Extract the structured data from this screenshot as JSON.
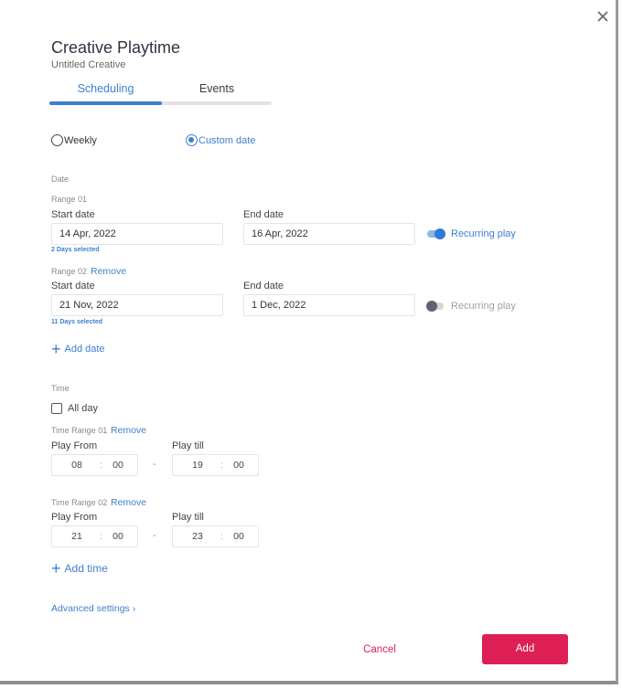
{
  "dialog": {
    "title": "Creative Playtime",
    "subtitle": "Untitled Creative",
    "close_icon": "close-icon"
  },
  "tabs": [
    {
      "label": "Scheduling",
      "active": true
    },
    {
      "label": "Events",
      "active": false
    }
  ],
  "schedule_type": {
    "options": [
      {
        "label": "Weekly",
        "selected": false
      },
      {
        "label": "Custom date",
        "selected": true
      }
    ]
  },
  "date": {
    "section_label": "Date",
    "ranges": [
      {
        "label": "Range 01",
        "remove_label": null,
        "start_label": "Start date",
        "start_value": "14 Apr, 2022",
        "end_label": "End date",
        "end_value": "16 Apr, 2022",
        "days_selected": "2 Days selected",
        "recurring_label": "Recurring play",
        "recurring_on": true
      },
      {
        "label": "Range 02",
        "remove_label": "Remove",
        "start_label": "Start date",
        "start_value": "21 Nov, 2022",
        "end_label": "End date",
        "end_value": "1 Dec, 2022",
        "days_selected": "11 Days selected",
        "recurring_label": "Recurring play",
        "recurring_on": false
      }
    ],
    "add_label": "Add date",
    "add_icon": "plus-icon"
  },
  "time": {
    "section_label": "Time",
    "all_day_label": "All day",
    "all_day_checked": false,
    "ranges": [
      {
        "label": "Time Range 01",
        "remove_label": "Remove",
        "from_label": "Play From",
        "from_hh": "08",
        "from_mm": "00",
        "till_label": "Play till",
        "till_hh": "19",
        "till_mm": "00",
        "separator": ":",
        "dash": "-"
      },
      {
        "label": "Time Range 02",
        "remove_label": "Remove",
        "from_label": "Play From",
        "from_hh": "21",
        "from_mm": "00",
        "till_label": "Play till",
        "till_hh": "23",
        "till_mm": "00",
        "separator": ":",
        "dash": "-"
      }
    ],
    "add_label": "Add time",
    "add_icon": "plus-icon"
  },
  "advanced_settings": {
    "label": "Advanced settings",
    "chevron": "›"
  },
  "footer": {
    "cancel_label": "Cancel",
    "add_label": "Add"
  },
  "colors": {
    "accent": "#3d7fce",
    "primary_button": "#dd1f55",
    "cancel_text": "#dc2055"
  }
}
